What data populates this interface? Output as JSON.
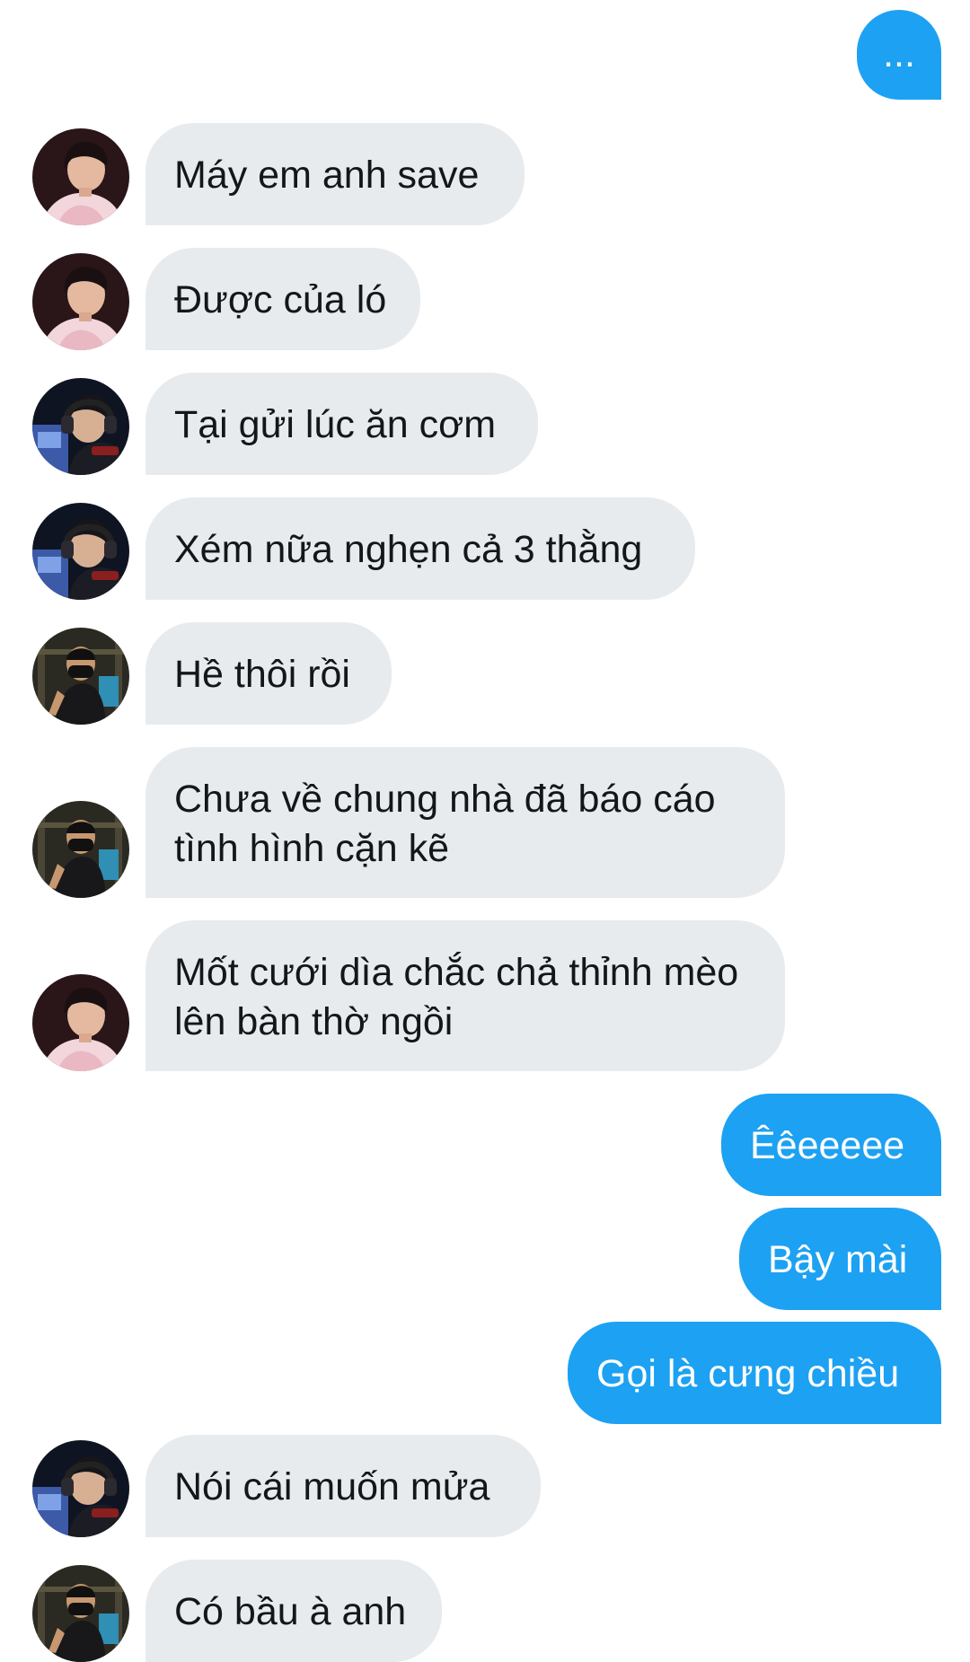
{
  "colors": {
    "incoming_bubble": "#e8ebee",
    "outgoing_bubble": "#1da1f2",
    "incoming_text": "#14171a",
    "outgoing_text": "#ffffff"
  },
  "messages": [
    {
      "direction": "outgoing",
      "text": "..."
    },
    {
      "direction": "incoming",
      "sender_avatar": "avatar-pink-hoodie",
      "text": "Máy em anh save"
    },
    {
      "direction": "incoming",
      "sender_avatar": "avatar-pink-hoodie",
      "text": "Được của ló"
    },
    {
      "direction": "incoming",
      "sender_avatar": "avatar-headphones",
      "text": "Tại gửi lúc ăn cơm"
    },
    {
      "direction": "incoming",
      "sender_avatar": "avatar-headphones",
      "text": "Xém nữa nghẹn cả 3 thằng"
    },
    {
      "direction": "incoming",
      "sender_avatar": "avatar-gym-mask",
      "text": "Hề thôi rồi"
    },
    {
      "direction": "incoming",
      "sender_avatar": "avatar-gym-mask",
      "text": "Chưa về chung nhà đã báo cáo tình hình cặn kẽ"
    },
    {
      "direction": "incoming",
      "sender_avatar": "avatar-pink-hoodie",
      "text": "Mốt cưới dìa chắc chả thỉnh mèo lên bàn thờ ngồi"
    },
    {
      "direction": "outgoing",
      "text": "Êêeeeee"
    },
    {
      "direction": "outgoing",
      "text": "Bậy mài"
    },
    {
      "direction": "outgoing",
      "text": "Gọi là cưng chiều"
    },
    {
      "direction": "incoming",
      "sender_avatar": "avatar-headphones",
      "text": "Nói cái muốn mửa"
    },
    {
      "direction": "incoming",
      "sender_avatar": "avatar-gym-mask",
      "text": "Có bầu à anh"
    }
  ]
}
